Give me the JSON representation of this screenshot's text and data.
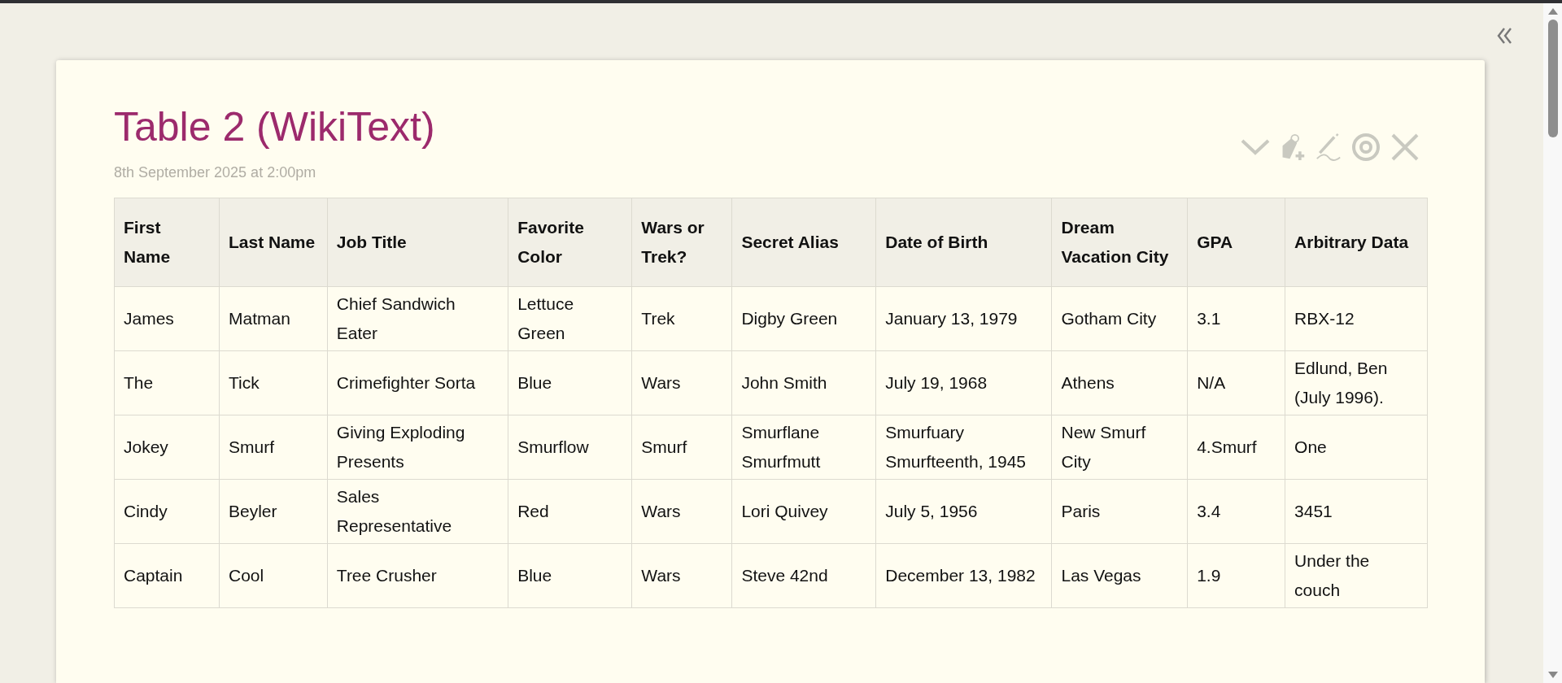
{
  "tiddler": {
    "title": "Table 2 (WikiText)",
    "subtitle": "8th September 2025 at 2:00pm",
    "table": {
      "columns": [
        "First Name",
        "Last Name",
        "Job Title",
        "Favorite Color",
        "Wars or Trek?",
        "Secret Alias",
        "Date of Birth",
        "Dream Vacation City",
        "GPA",
        "Arbitrary Data"
      ],
      "rows": [
        [
          "James",
          "Matman",
          "Chief Sandwich Eater",
          "Lettuce Green",
          "Trek",
          "Digby Green",
          "January 13, 1979",
          "Gotham City",
          "3.1",
          "RBX-12"
        ],
        [
          "The",
          "Tick",
          "Crimefighter Sorta",
          "Blue",
          "Wars",
          "John Smith",
          "July 19, 1968",
          "Athens",
          "N/A",
          "Edlund, Ben (July 1996)."
        ],
        [
          "Jokey",
          "Smurf",
          "Giving Exploding Presents",
          "Smurflow",
          "Smurf",
          "Smurflane Smurfmutt",
          "Smurfuary Smurfteenth, 1945",
          "New Smurf City",
          "4.Smurf",
          "One"
        ],
        [
          "Cindy",
          "Beyler",
          "Sales Representative",
          "Red",
          "Wars",
          "Lori Quivey",
          "July 5, 1956",
          "Paris",
          "3.4",
          "3451"
        ],
        [
          "Captain",
          "Cool",
          "Tree Crusher",
          "Blue",
          "Wars",
          "Steve 42nd",
          "December 13, 1982",
          "Las Vegas",
          "1.9",
          "Under the couch"
        ]
      ]
    }
  }
}
